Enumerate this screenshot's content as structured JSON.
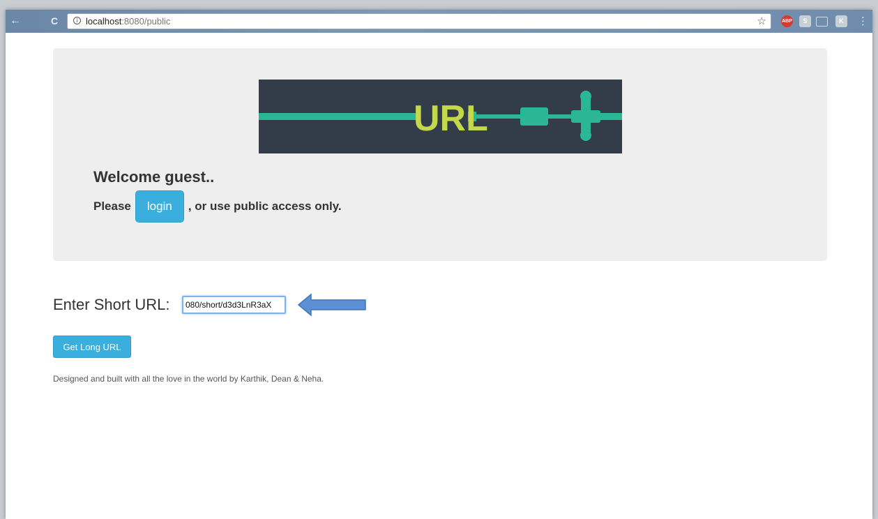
{
  "browser": {
    "url_host": "localhost",
    "url_rest": ":8080/public",
    "info_symbol": "i",
    "star_symbol": "☆",
    "back_symbol": "←",
    "reload_symbol": "C",
    "menu_symbol": "⋮",
    "extensions": [
      {
        "name": "adblock-plus-icon",
        "label": "ABP"
      },
      {
        "name": "extension-s-icon",
        "label": "S"
      },
      {
        "name": "cast-icon",
        "label": ""
      },
      {
        "name": "extension-k-icon",
        "label": "K"
      }
    ]
  },
  "banner": {
    "text": "URL",
    "text_color": "#c3d94b",
    "cable_color": "#2bb795",
    "background_color": "#2f3a44"
  },
  "hero": {
    "welcome": "Welcome guest..",
    "please": "Please",
    "login_label": "login",
    "after_login": ", or use public access only."
  },
  "form": {
    "label": "Enter Short URL:",
    "input_value": "080/short/d3d3LnR3aX",
    "submit_label": "Get Long URL"
  },
  "footer": {
    "text": "Designed and built with all the love in the world by Karthik, Dean & Neha."
  },
  "colors": {
    "accent": "#3aaedc",
    "arrow": "#5b8fd6"
  }
}
